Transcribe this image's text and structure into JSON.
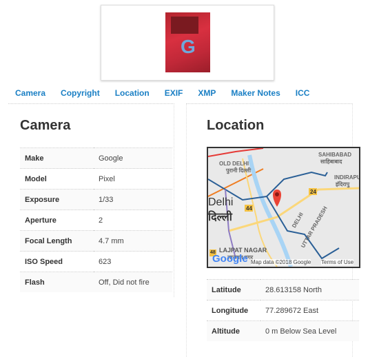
{
  "tabs": [
    "Camera",
    "Copyright",
    "Location",
    "EXIF",
    "XMP",
    "Maker Notes",
    "ICC"
  ],
  "camera": {
    "title": "Camera",
    "rows": [
      {
        "k": "Make",
        "v": "Google"
      },
      {
        "k": "Model",
        "v": "Pixel"
      },
      {
        "k": "Exposure",
        "v": "1/33"
      },
      {
        "k": "Aperture",
        "v": "2"
      },
      {
        "k": "Focal Length",
        "v": "4.7 mm"
      },
      {
        "k": "ISO Speed",
        "v": "623"
      },
      {
        "k": "Flash",
        "v": "Off, Did not fire"
      }
    ]
  },
  "location": {
    "title": "Location",
    "rows": [
      {
        "k": "Latitude",
        "v": "28.613158 North"
      },
      {
        "k": "Longitude",
        "v": "77.289672 East"
      },
      {
        "k": "Altitude",
        "v": "0 m Below Sea Level"
      }
    ],
    "map": {
      "labels": {
        "old_delhi": "OLD DELHI",
        "old_delhi_hi": "पुरानी दिल्ली",
        "sahibabad": "SAHIBABAD",
        "sahibabad_hi": "साहिबाबाद",
        "indirapuram": "INDIRAPU",
        "indirapuram_hi": "इंदिरापु",
        "delhi": "Delhi",
        "delhi_hi": "दिल्ली",
        "delhi_small": "DELHI",
        "up": "UTTAR PRADESH",
        "lajpat": "LAJPAT NAGAR",
        "lajpat_hi": "लाजपत नगर",
        "r24": "24",
        "r44": "44",
        "r48": "48"
      },
      "logo": "Google",
      "attribution": "Map data ©2018 Google",
      "terms": "Terms of Use"
    }
  }
}
